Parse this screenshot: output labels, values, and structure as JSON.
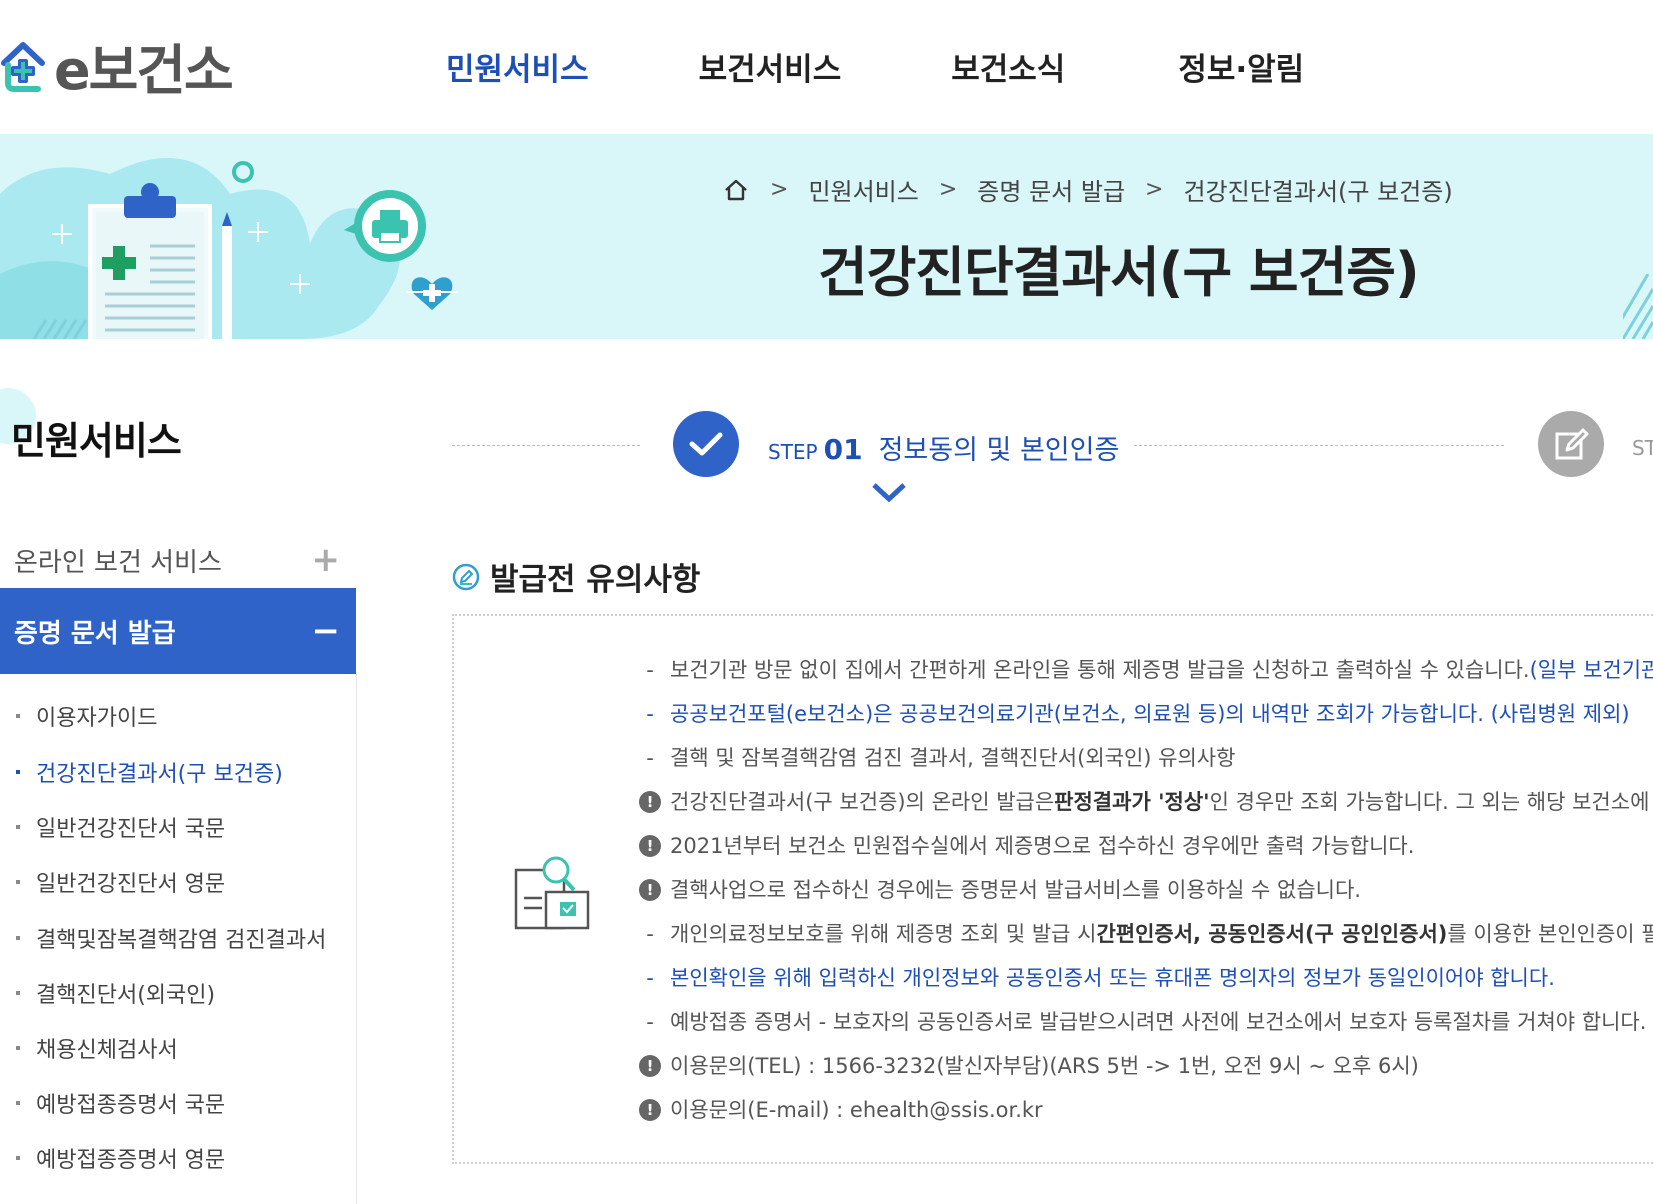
{
  "logo": {
    "text": "e보건소"
  },
  "nav": {
    "items": [
      "민원서비스",
      "보건서비스",
      "보건소식",
      "정보·알림"
    ],
    "active_index": 0
  },
  "breadcrumb": {
    "items": [
      "민원서비스",
      "증명 문서 발급",
      "건강진단결과서(구 보건증)"
    ],
    "separator": ">"
  },
  "page_title": "건강진단결과서(구 보건증)",
  "sidebar": {
    "title": "민원서비스",
    "online_label": "온라인 보건 서비스",
    "active_label": "증명 문서 발급",
    "subitems": [
      "이용자가이드",
      "건강진단결과서(구 보건증)",
      "일반건강진단서 국문",
      "일반건강진단서 영문",
      "결핵및잠복결핵감염 검진결과서",
      "결핵진단서(외국인)",
      "채용신체검사서",
      "예방접종증명서 국문",
      "예방접종증명서 영문"
    ],
    "active_sub_index": 1
  },
  "steps": {
    "step1_word": "STEP",
    "step1_num": "01",
    "step1_name": "정보동의 및 본인인증",
    "step2_partial": "ST"
  },
  "notice": {
    "title": "발급전 유의사항",
    "items": [
      {
        "marker": "-",
        "blue": false,
        "parts": [
          "보건기관 방문 없이 집에서 간편하게 온라인을 통해 제증명 발급을 신청하고 출력하실 수 있습니다.",
          "(일부 보건기관 제외)"
        ]
      },
      {
        "marker": "-",
        "blue": true,
        "parts": [
          "공공보건포털(e보건소)은 공공보건의료기관(보건소, 의료원 등)의 내역만 조회가 가능합니다. (사립병원 제외)"
        ]
      },
      {
        "marker": "-",
        "blue": false,
        "parts": [
          "결핵 및 잠복결핵감염 검진 결과서, 결핵진단서(외국인) 유의사항"
        ]
      },
      {
        "marker": "!",
        "blue": false,
        "parts": [
          "건강진단결과서(구 보건증)의 온라인 발급은 ",
          "판정결과가 '정상'",
          "인 경우만 조회 가능합니다. 그 외는 해당 보건소에 문의하시기 바랍니다."
        ]
      },
      {
        "marker": "!",
        "blue": false,
        "parts": [
          "2021년부터 보건소 민원접수실에서 제증명으로 접수하신 경우에만 출력 가능합니다."
        ]
      },
      {
        "marker": "!",
        "blue": false,
        "parts": [
          "결핵사업으로 접수하신 경우에는 증명문서 발급서비스를 이용하실 수 없습니다."
        ]
      },
      {
        "marker": "-",
        "blue": false,
        "parts": [
          "개인의료정보보호를 위해 제증명 조회 및 발급 시 ",
          "간편인증서, 공동인증서(구 공인인증서)",
          "를 이용한 본인인증이 필요합니다."
        ]
      },
      {
        "marker": "-",
        "blue": true,
        "parts": [
          "본인확인을 위해 입력하신 개인정보와 공동인증서 또는 휴대폰 명의자의 정보가 동일인이어야 합니다."
        ]
      },
      {
        "marker": "-",
        "blue": false,
        "parts": [
          "예방접종 증명서 - 보호자의 공동인증서로 발급받으시려면 사전에 보건소에서 보호자 등록절차를 거쳐야 합니다."
        ]
      },
      {
        "marker": "!",
        "blue": false,
        "parts": [
          "이용문의(TEL) : 1566-3232(발신자부담)(ARS 5번 -> 1번, 오전 9시 ~ 오후 6시)"
        ]
      },
      {
        "marker": "!",
        "blue": false,
        "parts": [
          "이용문의(E-mail) : ehealth@ssis.or.kr"
        ]
      }
    ]
  },
  "colors": {
    "primary": "#2f63c8",
    "nav_active": "#1e4fb5",
    "banner_bg": "#d9f6f8",
    "accent_teal": "#3cc3b0"
  },
  "icons": {
    "logo": "house-plus-icon",
    "home": "home-icon",
    "step1": "check-icon",
    "step2": "edit-icon",
    "section": "pencil-circle-icon",
    "notice": "document-search-icon"
  }
}
